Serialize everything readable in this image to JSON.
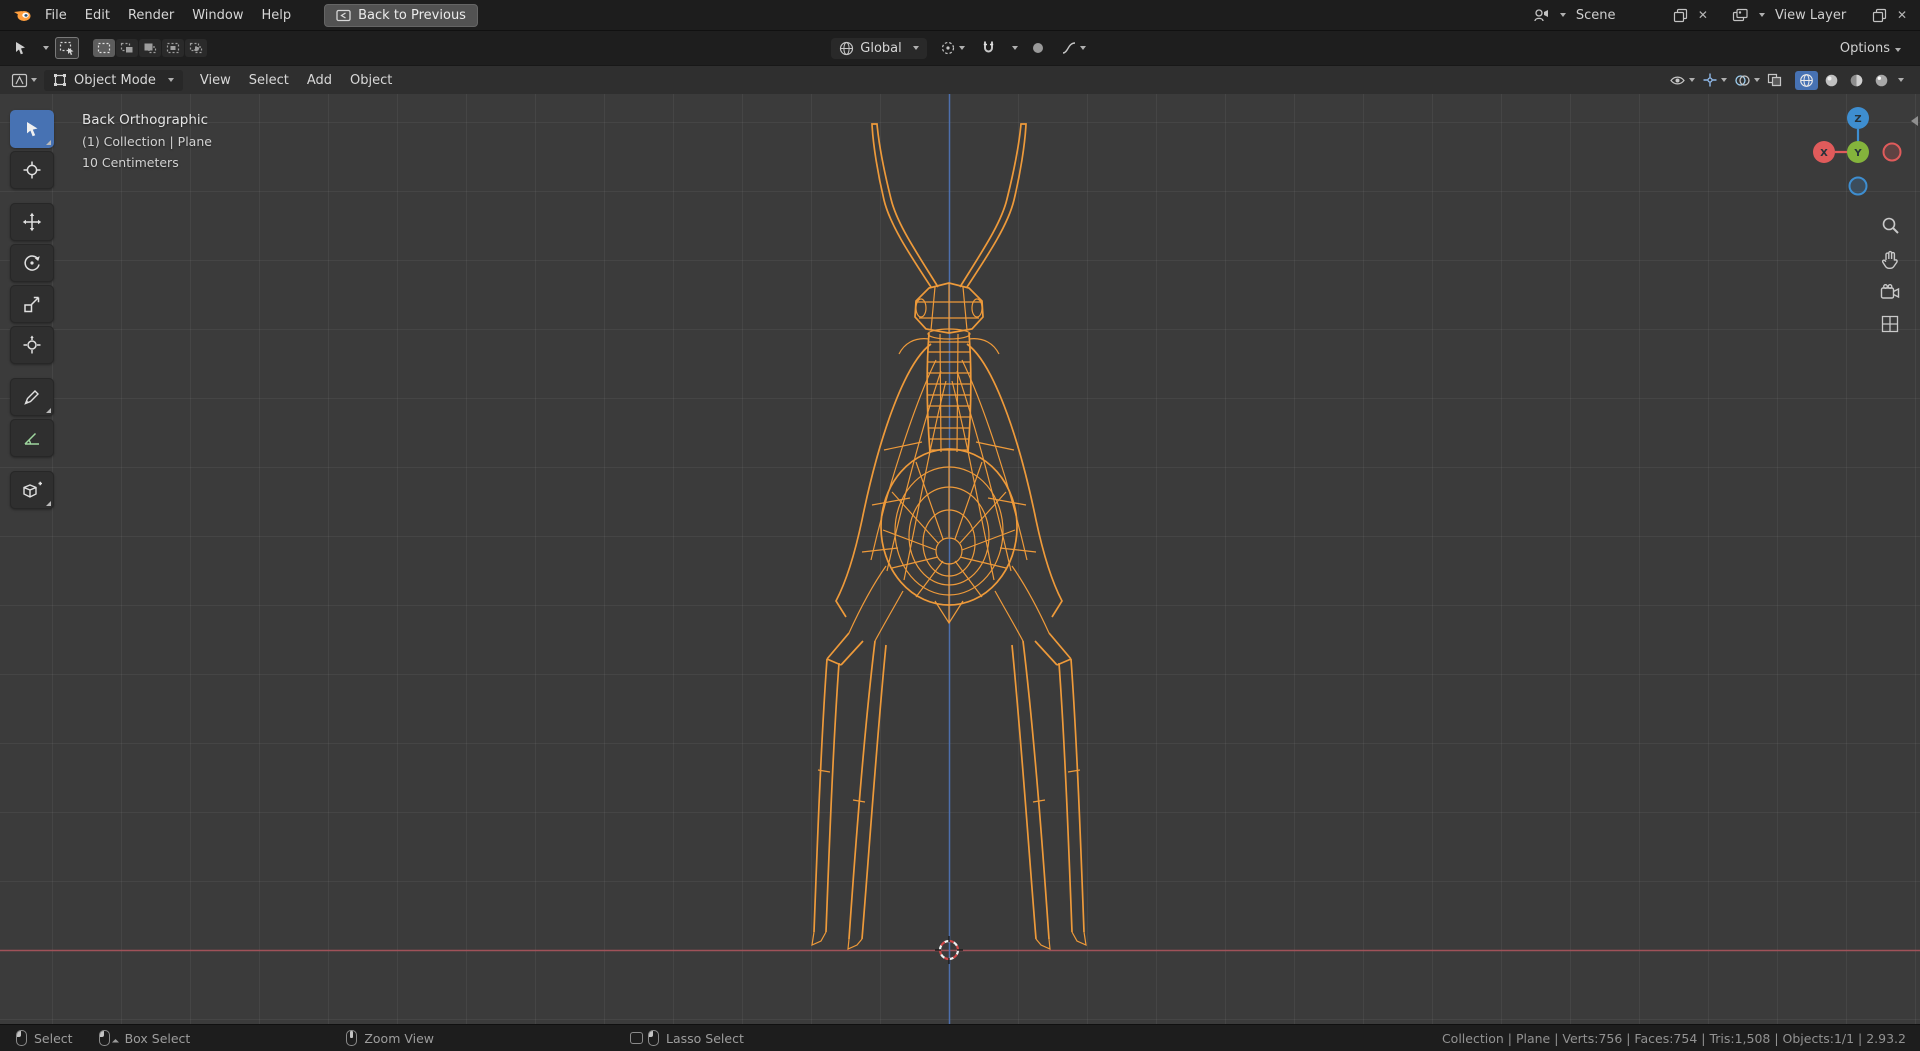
{
  "colors": {
    "accent": "#4772b3",
    "wire": "#ee9a3a",
    "axis_x": "#a5535b",
    "axis_z": "#4f74b8",
    "gizmo_x": "#e05b5b",
    "gizmo_y": "#84b43c",
    "gizmo_z": "#3e8ed0",
    "cursor_red": "#d04848"
  },
  "topbar": {
    "menus": [
      "File",
      "Edit",
      "Render",
      "Window",
      "Help"
    ],
    "back_label": "Back to Previous",
    "scene_label": "Scene",
    "view_layer_label": "View Layer"
  },
  "tool_settings": {
    "orientation_label": "Global",
    "options_label": "Options"
  },
  "viewport_header": {
    "mode_label": "Object Mode",
    "menus": [
      "View",
      "Select",
      "Add",
      "Object"
    ]
  },
  "viewport": {
    "view_label": "Back Orthographic",
    "context_label": "(1) Collection | Plane",
    "scale_label": "10 Centimeters"
  },
  "gizmo": {
    "x": "X",
    "y": "Y",
    "z": "Z"
  },
  "statusbar": {
    "hints": [
      "Select",
      "Box Select",
      "Zoom View",
      "Lasso Select"
    ],
    "info": "Collection | Plane | Verts:756 | Faces:754 | Tris:1,508 | Objects:1/1 | 2.93.2"
  }
}
